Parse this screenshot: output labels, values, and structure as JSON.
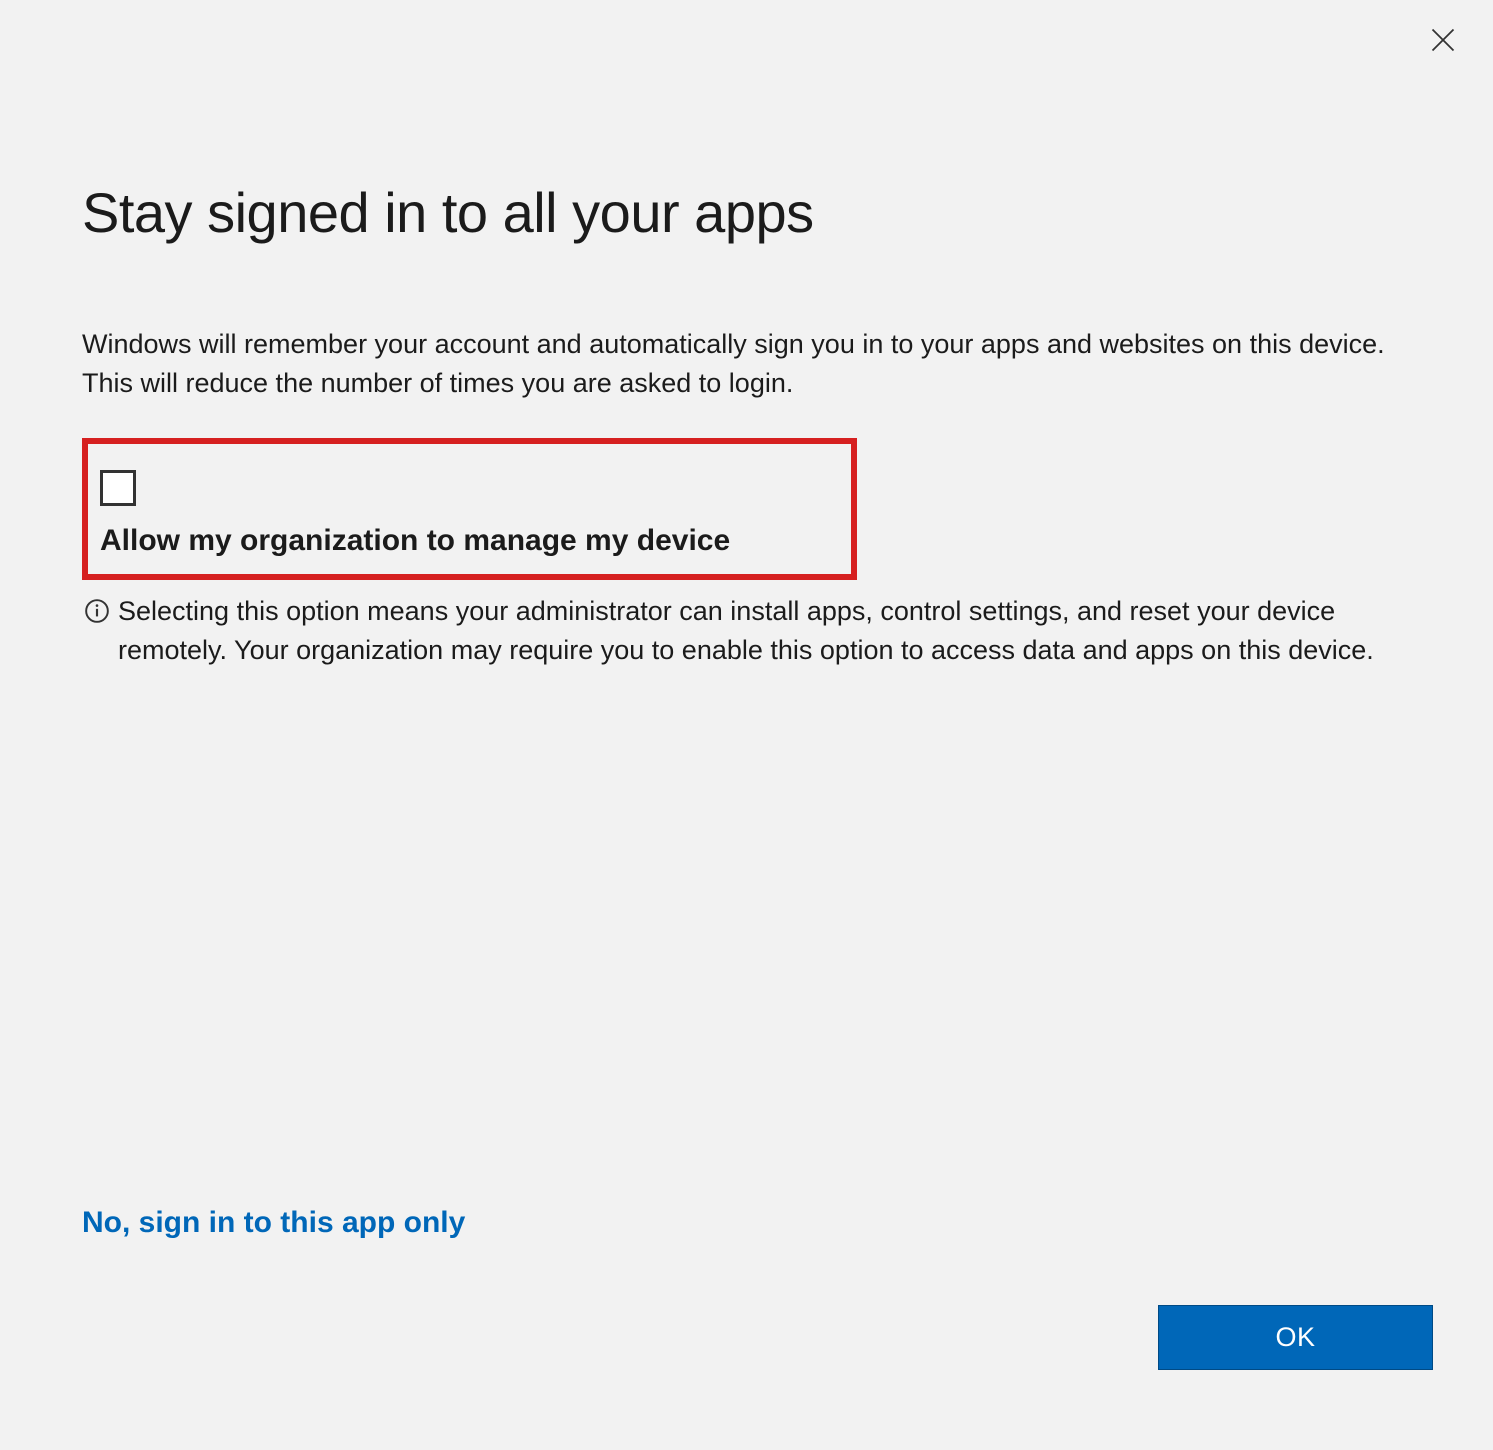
{
  "dialog": {
    "title": "Stay signed in to all your apps",
    "description": "Windows will remember your account and automatically sign you in to your apps and websites on this device. This will reduce the number of times you are asked to login.",
    "checkbox_label": "Allow my organization to manage my device",
    "info_text": "Selecting this option means your administrator can install apps, control settings, and reset your device remotely. Your organization may require you to enable this option to access data and apps on this device.",
    "link_label": "No, sign in to this app only",
    "ok_label": "OK"
  }
}
